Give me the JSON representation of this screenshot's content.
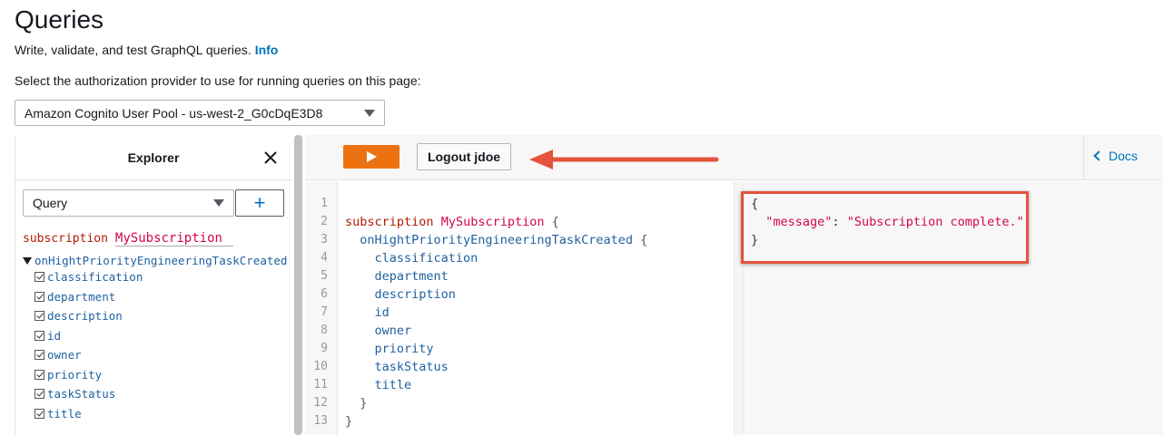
{
  "header": {
    "title": "Queries",
    "subtitle": "Write, validate, and test GraphQL queries.",
    "info_link": "Info",
    "auth_label": "Select the authorization provider to use for running queries on this page:",
    "auth_provider": "Amazon Cognito User Pool - us-west-2_G0cDqE3D8"
  },
  "explorer": {
    "title": "Explorer",
    "operation_type": "Query",
    "add_label": "+",
    "op_keyword": "subscription",
    "op_name": "MySubscription",
    "root_field": "onHightPriorityEngineeringTaskCreated",
    "fields": [
      "classification",
      "department",
      "description",
      "id",
      "owner",
      "priority",
      "taskStatus",
      "title"
    ]
  },
  "toolbar": {
    "logout_label": "Logout jdoe",
    "docs_label": "Docs"
  },
  "editor": {
    "line_numbers": [
      "1",
      "2",
      "3",
      "4",
      "5",
      "6",
      "7",
      "8",
      "9",
      "10",
      "11",
      "12",
      "13"
    ],
    "keyword": "subscription",
    "op_name": "MySubscription",
    "open_brace": "{",
    "root_field": "onHightPriorityEngineeringTaskCreated",
    "fields": [
      "classification",
      "department",
      "description",
      "id",
      "owner",
      "priority",
      "taskStatus",
      "title"
    ],
    "close_inner": "}",
    "close_outer": "}"
  },
  "result": {
    "open": "{",
    "key": "\"message\"",
    "colon": ": ",
    "value": "\"Subscription complete.\"",
    "close": "}"
  },
  "colors": {
    "run_button": "#ec7211",
    "link": "#0073bb",
    "keyword": "#b11a04",
    "name": "#d2054e",
    "field": "#1f61a0",
    "annotation": "#e5533d"
  },
  "icons": [
    "caret-down-icon",
    "close-icon",
    "plus-icon",
    "play-icon",
    "chevron-left-icon",
    "annotation-arrow"
  ]
}
